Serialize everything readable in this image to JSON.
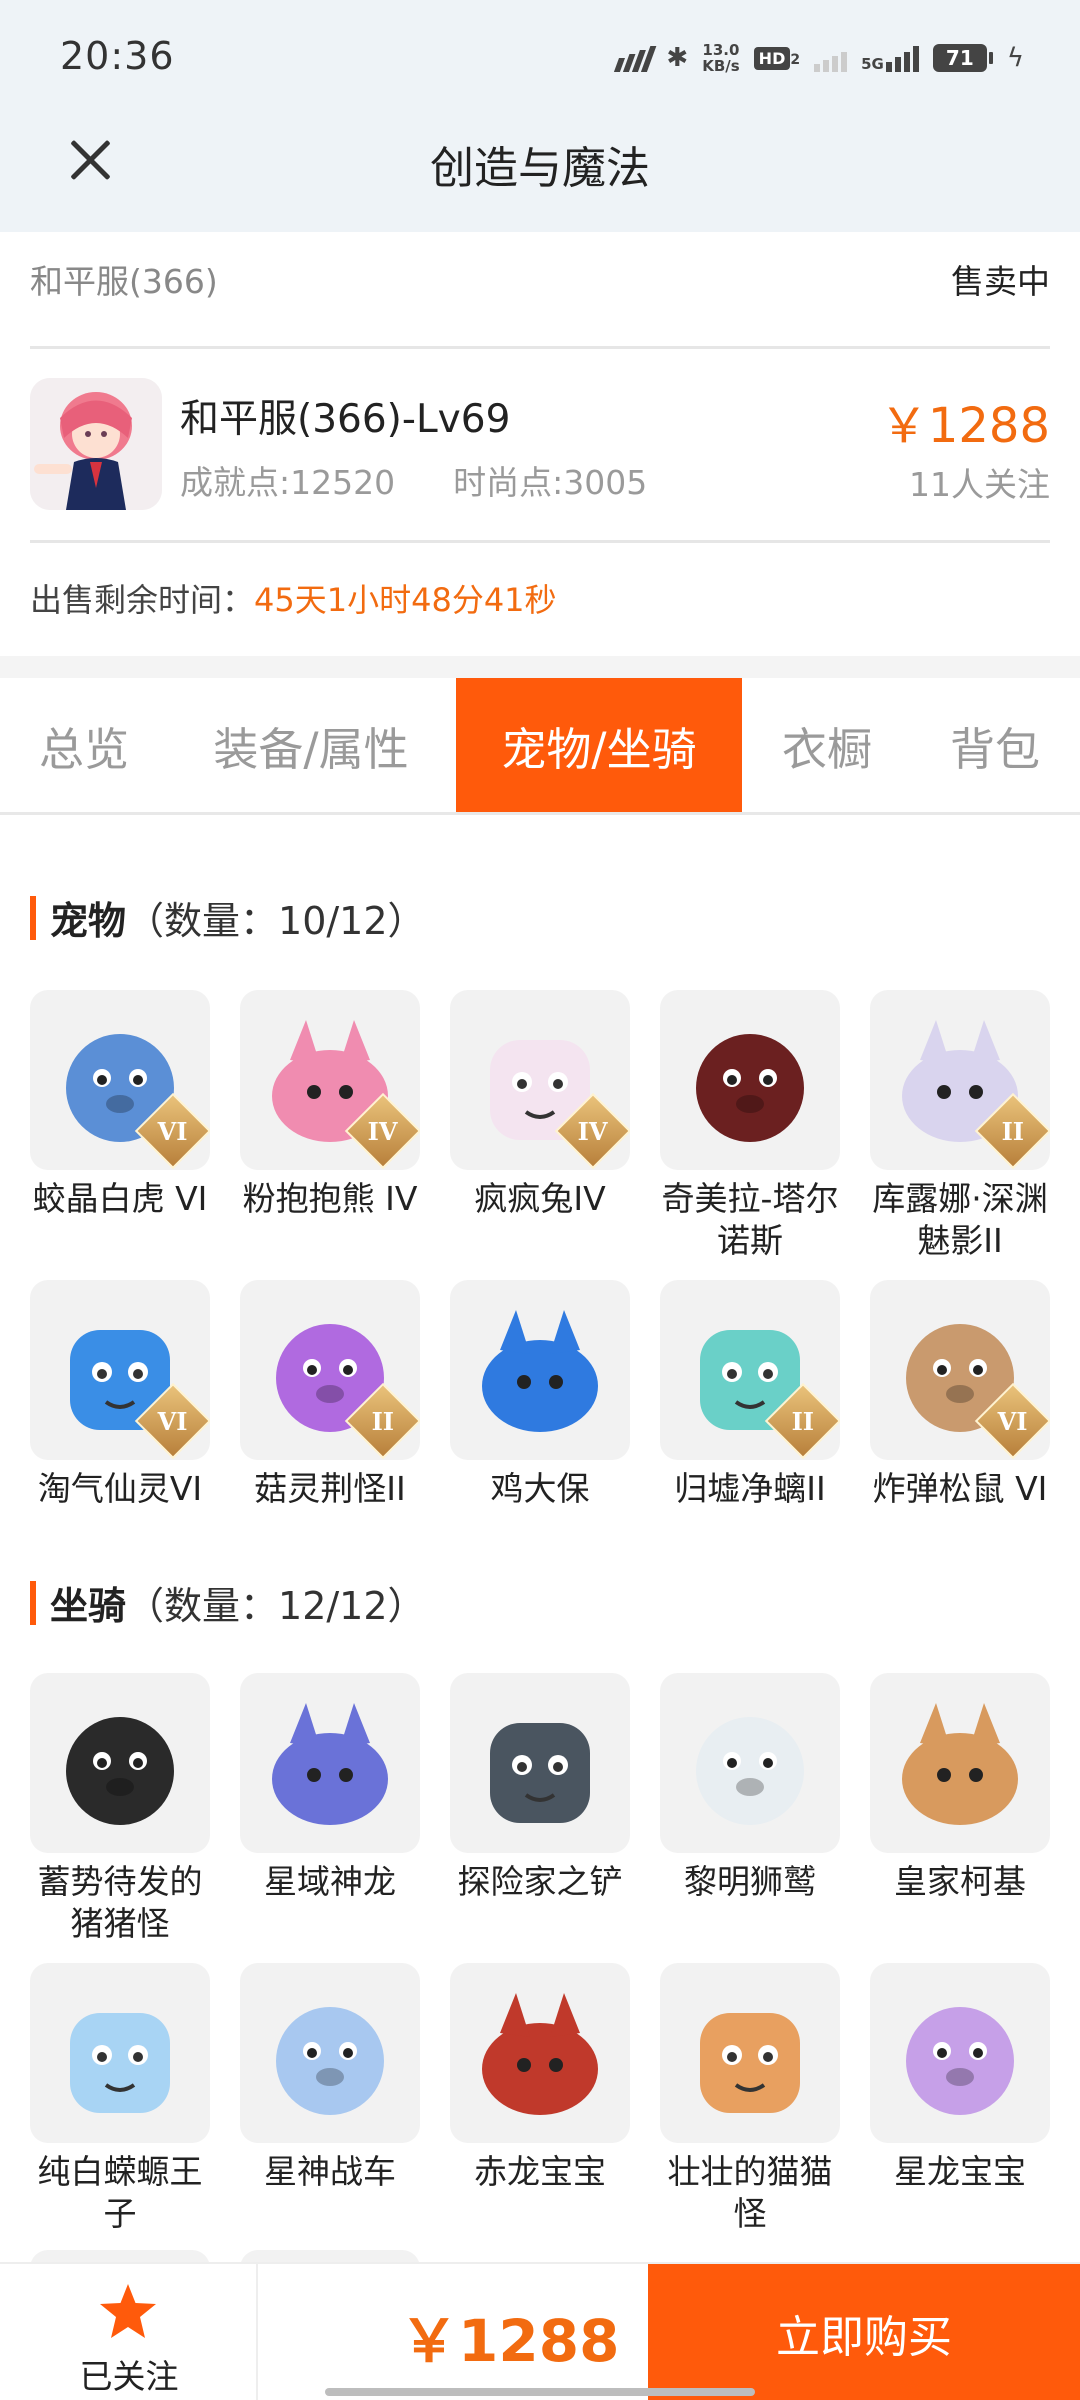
{
  "status_bar": {
    "time": "20:36",
    "speed_value": "13.0",
    "speed_unit": "KB/s",
    "hd_label": "HD",
    "hd_sub": "2",
    "network": "5G",
    "battery": "71"
  },
  "header": {
    "title": "创造与魔法"
  },
  "listing": {
    "server": "和平服(366)",
    "status": "售卖中",
    "character_name": "和平服(366)-Lv69",
    "achievement_points": "成就点:12520",
    "fashion_points": "时尚点:3005",
    "price": "￥1288",
    "followers": "11人关注",
    "remaining_label": "出售剩余时间：",
    "remaining_time": "45天1小时48分41秒"
  },
  "tabs": [
    {
      "label": "总览",
      "active": false
    },
    {
      "label": "装备/属性",
      "active": false
    },
    {
      "label": "宠物/坐骑",
      "active": true
    },
    {
      "label": "衣橱",
      "active": false
    },
    {
      "label": "背包",
      "active": false
    }
  ],
  "pets": {
    "title": "宠物",
    "count": "（数量：10/12）",
    "items": [
      {
        "name": "蛟晶白虎 VI",
        "badge": "VI",
        "icon": "white-tiger-icon",
        "color": "#5b8fd6"
      },
      {
        "name": "粉抱抱熊 IV",
        "badge": "IV",
        "icon": "pink-bear-icon",
        "color": "#f08cb0"
      },
      {
        "name": "疯疯兔IV",
        "badge": "IV",
        "icon": "rabbit-icon",
        "color": "#f4e4f0"
      },
      {
        "name": "奇美拉-塔尔诺斯",
        "badge": "",
        "icon": "chimera-icon",
        "color": "#6b2020"
      },
      {
        "name": "库露娜·深渊魅影II",
        "badge": "II",
        "icon": "kuluna-icon",
        "color": "#d9d4ee"
      },
      {
        "name": "淘气仙灵VI",
        "badge": "VI",
        "icon": "blue-dog-icon",
        "color": "#3a8ee6"
      },
      {
        "name": "菇灵荆怪II",
        "badge": "II",
        "icon": "mushroom-sprite-icon",
        "color": "#b06ae0"
      },
      {
        "name": "鸡大保",
        "badge": "",
        "icon": "blue-chicken-icon",
        "color": "#2f7ae0"
      },
      {
        "name": "归墟净螭II",
        "badge": "II",
        "icon": "jade-dragon-icon",
        "color": "#6ad0c8"
      },
      {
        "name": "炸弹松鼠 VI",
        "badge": "VI",
        "icon": "bomb-squirrel-icon",
        "color": "#c99a6e"
      }
    ]
  },
  "mounts": {
    "title": "坐骑",
    "count": "（数量：12/12）",
    "items": [
      {
        "name": "蓄势待发的猪猪怪",
        "icon": "black-pig-icon",
        "color": "#2a2a2a"
      },
      {
        "name": "星域神龙",
        "icon": "star-dragon-icon",
        "color": "#6a72d8"
      },
      {
        "name": "探险家之铲",
        "icon": "shovel-icon",
        "color": "#4a5560"
      },
      {
        "name": "黎明狮鹫",
        "icon": "griffin-icon",
        "color": "#e8eef2"
      },
      {
        "name": "皇家柯基",
        "icon": "corgi-icon",
        "color": "#d89a5e"
      },
      {
        "name": "纯白蝾螈王子",
        "icon": "axolotl-icon",
        "color": "#a8d4f4"
      },
      {
        "name": "星神战车",
        "icon": "chariot-horse-icon",
        "color": "#a8c8f0"
      },
      {
        "name": "赤龙宝宝",
        "icon": "red-dragon-icon",
        "color": "#c0392b"
      },
      {
        "name": "壮壮的猫猫怪",
        "icon": "cat-icon",
        "color": "#e8a060"
      },
      {
        "name": "星龙宝宝",
        "icon": "baby-star-dragon-icon",
        "color": "#c6a0e8"
      }
    ]
  },
  "bottom_bar": {
    "follow_label": "已关注",
    "price": "￥1288",
    "buy_label": "立即购买"
  },
  "colors": {
    "accent": "#ff5a0b",
    "price": "#f26b10"
  }
}
